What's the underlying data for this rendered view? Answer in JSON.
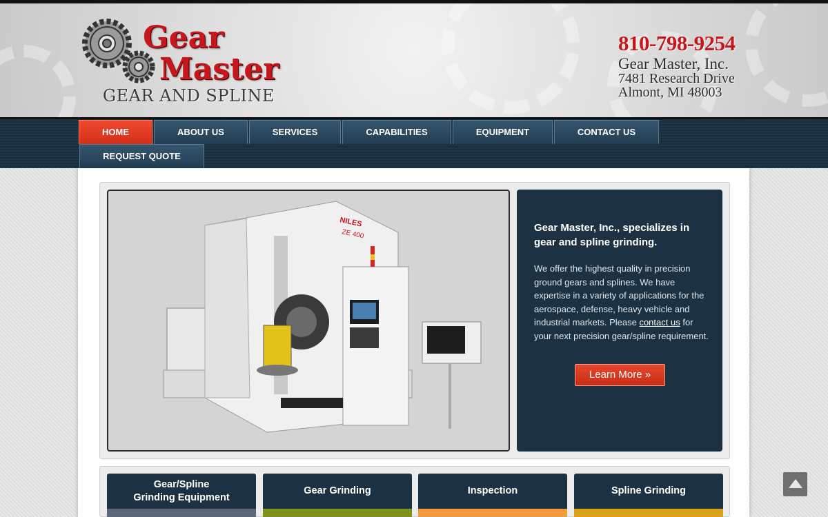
{
  "brand": {
    "word1": "Gear",
    "word2": "Master",
    "tagline": "GEAR AND SPLINE",
    "red": "#c8161d"
  },
  "contact": {
    "phone": "810-798-9254",
    "company": "Gear Master, Inc.",
    "street": "7481 Research Drive",
    "city": "Almont, MI 48003"
  },
  "nav": {
    "items": [
      {
        "label": "HOME",
        "active": true
      },
      {
        "label": "ABOUT US"
      },
      {
        "label": "SERVICES"
      },
      {
        "label": "CAPABILITIES"
      },
      {
        "label": "EQUIPMENT"
      },
      {
        "label": "CONTACT US"
      },
      {
        "label": "REQUEST QUOTE"
      }
    ]
  },
  "feature": {
    "machine_label": "NILES",
    "machine_model": "ZE 400",
    "title": "Gear Master, Inc., specializes in gear and spline grinding.",
    "body_pre": "We offer the highest quality in precision ground gears and splines.  We have expertise in a variety of applications for the aerospace, defense, heavy vehicle and industrial markets.  Please ",
    "link": "contact us",
    "body_post": " for your next precision gear/spline requirement.",
    "button": "Learn More »"
  },
  "tiles": [
    {
      "label": "Gear/Spline Grinding Equipment",
      "line1": "Gear/Spline",
      "line2": "Grinding Equipment",
      "color": "#5c6878"
    },
    {
      "label": "Gear Grinding",
      "color": "#7d9218"
    },
    {
      "label": "Inspection",
      "color": "#f19a3e"
    },
    {
      "label": "Spline Grinding",
      "color": "#d8a21c"
    }
  ],
  "scroll_top_icon": "arrow-up-icon"
}
